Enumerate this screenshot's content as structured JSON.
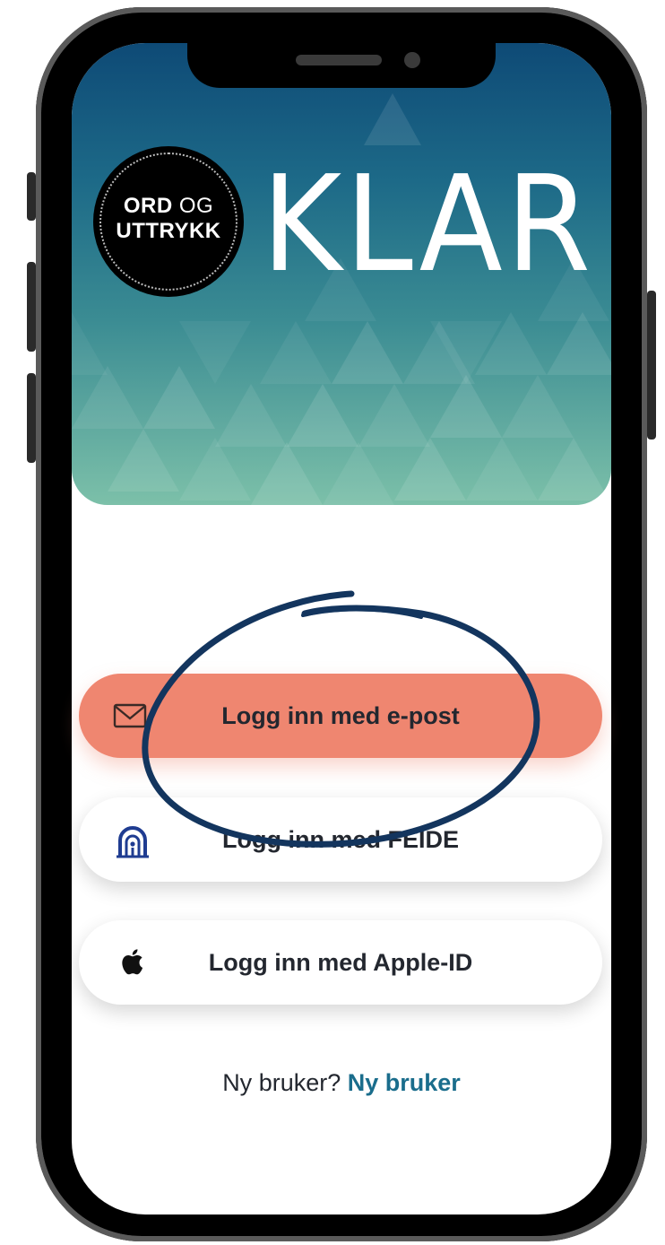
{
  "app": {
    "logo_line1_bold": "ORD",
    "logo_line1_light": "OG",
    "logo_line2": "UTTRYKK",
    "brand_name": "KLAR"
  },
  "login": {
    "email_label": "Logg inn med e-post",
    "feide_label": "Logg inn med FEIDE",
    "apple_label": "Logg inn med Apple-ID",
    "email_icon": "envelope-icon",
    "feide_icon": "feide-icon",
    "apple_icon": "apple-logo-icon"
  },
  "signup": {
    "prompt": "Ny bruker?",
    "link": "Ny bruker"
  },
  "colors": {
    "header_top": "#0e4a76",
    "header_bottom": "#7cc0a9",
    "email_button": "#ef8670",
    "link": "#1a6d8c",
    "annotation": "#13355e"
  }
}
